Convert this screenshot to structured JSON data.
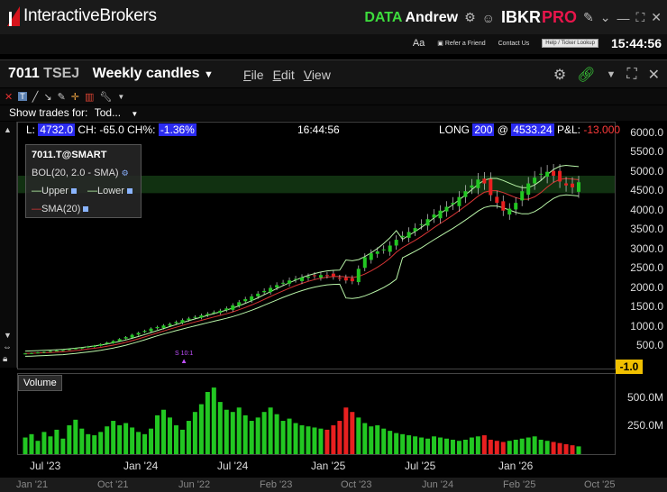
{
  "app": {
    "brand": "InteractiveBrokers",
    "data_label": "DATA",
    "user": "Andrew",
    "ibkr": "IBKR",
    "pro": "PRO",
    "refer": "Refer a Friend",
    "contact": "Contact Us",
    "help_placeholder": "Help / Ticker Lookup",
    "clock": "15:44:56"
  },
  "window": {
    "symbol": "7011",
    "exchange": "TSEJ",
    "period": "Weekly candles",
    "menus": [
      "File",
      "Edit",
      "View"
    ]
  },
  "toolbar": {
    "trades_label": "Show trades for:",
    "trades_value": "Tod..."
  },
  "info": {
    "last_label": "L:",
    "last": "4732.0",
    "ch_label": "CH:",
    "ch": "-65.0",
    "chp_label": "CH%:",
    "chp": "-1.36%",
    "time": "16:44:56",
    "pos_label": "LONG",
    "qty": "200",
    "at": "@",
    "avg": "4533.24",
    "pnl_label": "P&L:",
    "pnl": "-13.000"
  },
  "legend": {
    "contract": "7011.T@SMART",
    "bol": "BOL(20, 2.0 - SMA)",
    "upper": "Upper",
    "lower": "Lower",
    "sma": "SMA(20)"
  },
  "split_marker": "S 10:1",
  "volume_label": "Volume",
  "price_marker": "-1.0",
  "colors": {
    "up": "#22c722",
    "down": "#e82020",
    "band": "#b9f5a8",
    "sma": "#d93535",
    "highlight": "#2b2bf0"
  },
  "chart_data": {
    "type": "candlestick",
    "price_axis": {
      "ylim": [
        0,
        6200
      ],
      "ticks": [
        "6000.0",
        "5500.0",
        "5000.0",
        "4500.0",
        "4000.0",
        "3500.0",
        "3000.0",
        "2500.0",
        "2000.0",
        "1500.0",
        "1000.0",
        "500.0"
      ],
      "tick_values": [
        6000,
        5500,
        5000,
        4500,
        4000,
        3500,
        3000,
        2500,
        2000,
        1500,
        1000,
        500
      ]
    },
    "volume_axis": {
      "ylim": [
        0,
        690
      ],
      "ticks": [
        "500.0M",
        "250.0M"
      ],
      "tick_values": [
        500,
        250
      ]
    },
    "x_ticks": [
      "Jul '23",
      "Jan '24",
      "Jul '24",
      "Jan '25",
      "Jul '25",
      "Jan '26"
    ],
    "nav_ticks": [
      "Jan '21",
      "Oct '21",
      "Jun '22",
      "Feb '23",
      "Oct '23",
      "Jun '24",
      "Feb '25",
      "Oct '25"
    ],
    "close_series": [
      320,
      330,
      345,
      360,
      380,
      395,
      410,
      430,
      450,
      470,
      500,
      520,
      560,
      600,
      640,
      690,
      740,
      800,
      850,
      900,
      960,
      1000,
      1040,
      1080,
      1130,
      1180,
      1220,
      1260,
      1300,
      1340,
      1380,
      1420,
      1480,
      1560,
      1640,
      1720,
      1790,
      1860,
      1930,
      2010,
      2080,
      2140,
      2200,
      2240,
      2280,
      2300,
      2320,
      2340,
      2330,
      2300,
      2260,
      2200,
      2180,
      2500,
      2800,
      2900,
      2950,
      3000,
      3100,
      3250,
      3350,
      3450,
      3550,
      3650,
      3780,
      3900,
      4000,
      4100,
      4200,
      4350,
      4500,
      4650,
      4800,
      4700,
      4400,
      4200,
      4000,
      4050,
      4200,
      4500,
      4700,
      4850,
      4950,
      5000,
      4900,
      4750,
      4650,
      4600,
      4732
    ],
    "volume_series": [
      150,
      180,
      120,
      200,
      160,
      220,
      140,
      260,
      310,
      230,
      180,
      170,
      200,
      250,
      300,
      260,
      280,
      240,
      200,
      180,
      230,
      350,
      400,
      330,
      260,
      220,
      300,
      380,
      450,
      560,
      600,
      470,
      400,
      380,
      420,
      350,
      300,
      330,
      380,
      420,
      360,
      300,
      320,
      280,
      260,
      250,
      240,
      230,
      220,
      260,
      300,
      420,
      380,
      330,
      280,
      250,
      260,
      230,
      210,
      190,
      180,
      170,
      160,
      150,
      140,
      160,
      150,
      140,
      130,
      120,
      130,
      150,
      160,
      170,
      130,
      120,
      110,
      120,
      130,
      140,
      150,
      160,
      130,
      120,
      110,
      100,
      90,
      80,
      70
    ]
  }
}
